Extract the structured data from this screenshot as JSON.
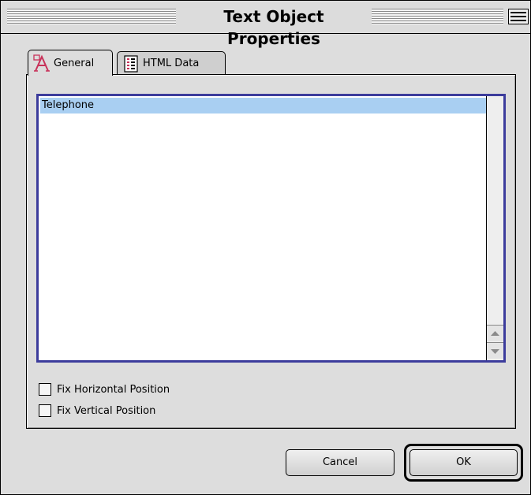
{
  "window": {
    "title": "Text Object Properties"
  },
  "tabs": [
    {
      "label": "General",
      "icon": "text-tool-icon",
      "active": true
    },
    {
      "label": "HTML Data",
      "icon": "html-document-icon",
      "active": false
    }
  ],
  "list": {
    "items": [
      "Telephone"
    ],
    "selected_index": 0
  },
  "options": {
    "fix_horizontal": {
      "label": "Fix Horizontal Position",
      "checked": false
    },
    "fix_vertical": {
      "label": "Fix Vertical Position",
      "checked": false
    }
  },
  "buttons": {
    "cancel_label": "Cancel",
    "ok_label": "OK"
  },
  "colors": {
    "selection": "#a9cff2",
    "focus_ring": "#3c3c9c",
    "text_tool_icon": "#c8325a"
  }
}
